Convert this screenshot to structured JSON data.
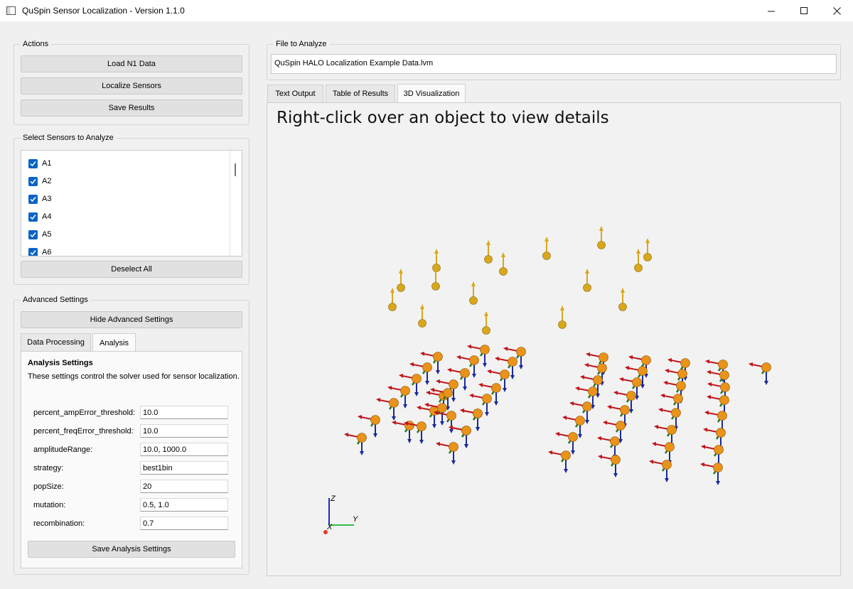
{
  "window": {
    "title": "QuSpin Sensor Localization - Version 1.1.0"
  },
  "actions": {
    "group_label": "Actions",
    "load_button": "Load N1 Data",
    "localize_button": "Localize Sensors",
    "save_button": "Save Results"
  },
  "sensors": {
    "group_label": "Select Sensors to Analyze",
    "items": [
      {
        "label": "A1",
        "checked": true
      },
      {
        "label": "A2",
        "checked": true
      },
      {
        "label": "A3",
        "checked": true
      },
      {
        "label": "A4",
        "checked": true
      },
      {
        "label": "A5",
        "checked": true
      },
      {
        "label": "A6",
        "checked": true
      }
    ],
    "deselect_button": "Deselect All"
  },
  "advanced": {
    "group_label": "Advanced Settings",
    "hide_button": "Hide Advanced Settings",
    "tabs": [
      {
        "label": "Data Processing",
        "active": false
      },
      {
        "label": "Analysis",
        "active": true
      }
    ],
    "analysis": {
      "heading": "Analysis Settings",
      "description": "These settings control the solver used for sensor localization.",
      "fields": [
        {
          "label": "percent_ampError_threshold:",
          "value": "10.0"
        },
        {
          "label": "percent_freqError_threshold:",
          "value": "10.0"
        },
        {
          "label": "amplitudeRange:",
          "value": "10.0, 1000.0"
        },
        {
          "label": "strategy:",
          "value": "best1bin"
        },
        {
          "label": "popSize:",
          "value": "20"
        },
        {
          "label": "mutation:",
          "value": "0.5, 1.0"
        },
        {
          "label": "recombination:",
          "value": "0.7"
        }
      ],
      "save_button": "Save Analysis Settings"
    }
  },
  "file": {
    "group_label": "File to Analyze",
    "value": "QuSpin HALO Localization Example Data.lvm"
  },
  "main_tabs": [
    {
      "label": "Text Output",
      "active": false
    },
    {
      "label": "Table of Results",
      "active": false
    },
    {
      "label": "3D Visualization",
      "active": true
    }
  ],
  "visualization": {
    "hint": "Right-click over an object to view details",
    "axis_labels": {
      "z": "Z",
      "y": "Y",
      "x": "X"
    },
    "colors": {
      "reference_sphere": "#d9a81a",
      "sensor_sphere": "#e8931a",
      "arrow_red": "#c0161b",
      "arrow_blue": "#1a2a9c",
      "arrow_green": "#2a7a20",
      "axis_z": "#1a2ad0",
      "axis_y": "#2fbf4f",
      "axis_x_dot": "#e43a2a"
    }
  }
}
